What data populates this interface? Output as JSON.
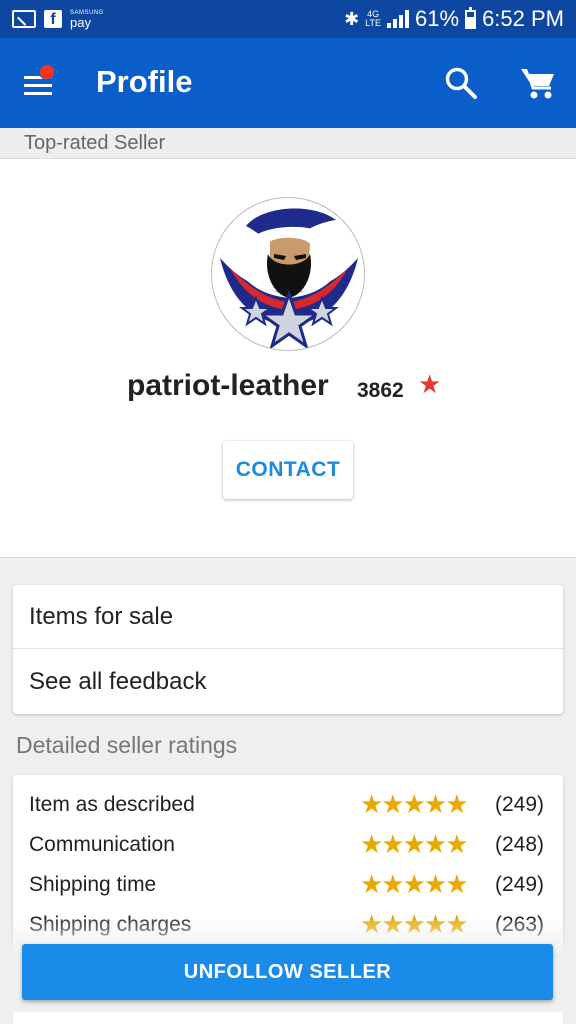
{
  "status_bar": {
    "pay_brand": "SAMSUNG",
    "pay_label": "pay",
    "lte_top": "4G",
    "lte_bottom": "LTE",
    "battery": "61%",
    "time": "6:52 PM"
  },
  "app_bar": {
    "title": "Profile",
    "notification_dot_color": "#f4341e"
  },
  "seller": {
    "badge": "Top-rated Seller",
    "name": "patriot-leather",
    "feedback_score": "3862",
    "star": "★",
    "star_color": "#e53935",
    "contact_label": "CONTACT"
  },
  "links": {
    "items_for_sale": "Items for sale",
    "see_all_feedback": "See all feedback"
  },
  "ratings": {
    "section_title": "Detailed seller ratings",
    "star_color": "#e9a903",
    "rows": [
      {
        "label": "Item as described",
        "stars": "★★★★★",
        "rating": 5,
        "count": "(249)"
      },
      {
        "label": "Communication",
        "stars": "★★★★★",
        "rating": 5,
        "count": "(248)"
      },
      {
        "label": "Shipping time",
        "stars": "★★★★★",
        "rating": 5,
        "count": "(249)"
      },
      {
        "label": "Shipping charges",
        "stars": "★★★★★",
        "rating": 5,
        "count": "(263)"
      }
    ]
  },
  "footer": {
    "unfollow_label": "UNFOLLOW SELLER"
  },
  "colors": {
    "status_bar": "#0d47a1",
    "app_bar": "#0a5ec9",
    "accent": "#1a8be8"
  }
}
